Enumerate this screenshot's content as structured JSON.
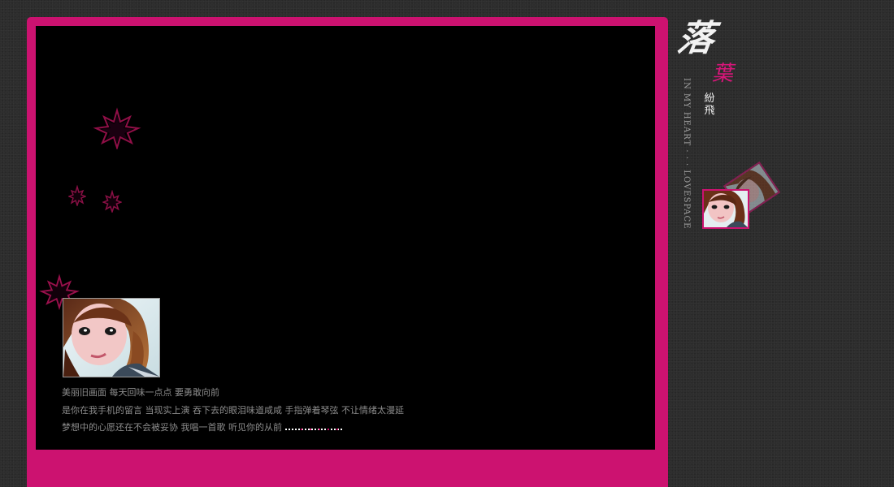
{
  "logo": {
    "title_char_1": "落",
    "title_char_2": "葉",
    "subtitle": "紛飛",
    "vertical_text": "IN MY HEART · · · LOVESPACE"
  },
  "lyrics": [
    "美丽旧画面 每天回味一点点 要勇敢向前",
    "是你在我手机的留言 当现实上演 吞下去的眼泪味道咸咸 手指弹着琴弦 不让情绪太漫延",
    "梦想中的心愿还在不会被妥协 我唱一首歌 听见你的从前"
  ],
  "colors": {
    "accent": "#cc1270",
    "screen": "#000000",
    "background": "#2d2d2d",
    "lyric_text": "#8c8c8c"
  },
  "icons": [
    "maple-leaf-icon",
    "maple-leaf-icon",
    "maple-leaf-icon",
    "maple-leaf-icon"
  ]
}
